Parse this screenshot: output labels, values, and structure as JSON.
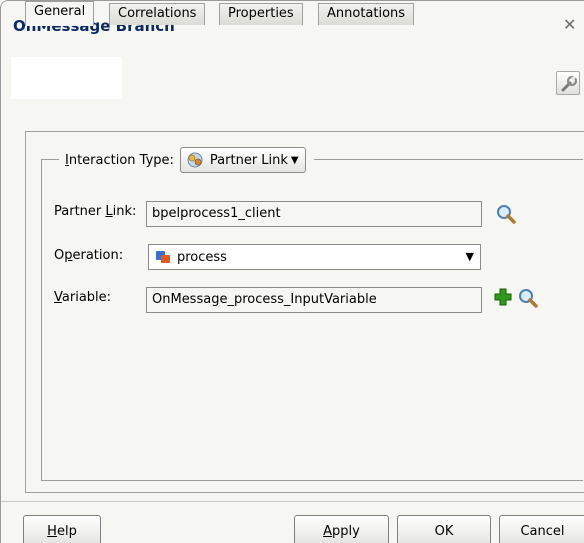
{
  "dialog": {
    "title": "OnMessage Branch",
    "close_icon": "close-x-icon",
    "config_icon": "wrench-icon"
  },
  "tabs": [
    {
      "label": "General",
      "active": true
    },
    {
      "label": "Correlations",
      "active": false
    },
    {
      "label": "Properties",
      "active": false
    },
    {
      "label": "Annotations",
      "active": false
    }
  ],
  "general": {
    "interaction_type": {
      "label_pre": "I",
      "label_rest": "nteraction Type:",
      "value": "Partner Link",
      "icon": "partner-link-icon"
    },
    "partner_link": {
      "label_pre": "Partner ",
      "label_u": "L",
      "label_post": "ink:",
      "value": "bpelprocess1_client",
      "browse_icon": "magnifier-icon"
    },
    "operation": {
      "label_pre": "O",
      "label_u": "p",
      "label_post": "eration:",
      "value": "process",
      "icon": "operation-icon"
    },
    "variable": {
      "label_u": "V",
      "label_post": "ariable:",
      "value": "OnMessage_process_InputVariable",
      "add_icon": "plus-icon",
      "browse_icon": "magnifier-icon"
    }
  },
  "buttons": {
    "help_u": "H",
    "help_rest": "elp",
    "apply_u": "A",
    "apply_rest": "pply",
    "ok": "OK",
    "cancel": "Cancel"
  },
  "colors": {
    "title": "#0b2a66",
    "dialog_bg": "#f6f6f3",
    "add_green": "#2f9a1a"
  }
}
